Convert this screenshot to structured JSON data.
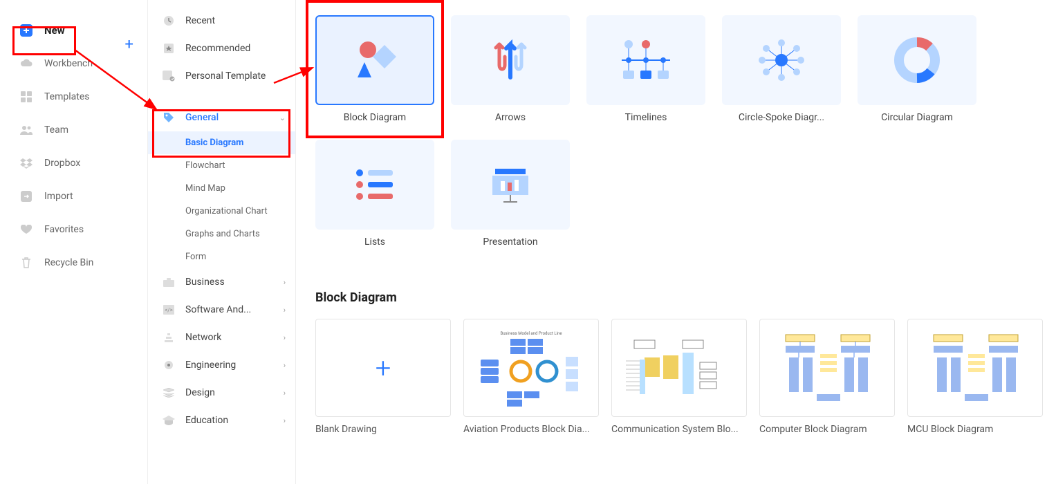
{
  "leftNav": {
    "new": "New",
    "workbench": "Workbench",
    "templates": "Templates",
    "team": "Team",
    "dropbox": "Dropbox",
    "import": "Import",
    "favorites": "Favorites",
    "recycle": "Recycle Bin"
  },
  "catNav": {
    "recent": "Recent",
    "recommended": "Recommended",
    "personal": "Personal Template",
    "general": "General",
    "general_subs": {
      "basic": "Basic Diagram",
      "flowchart": "Flowchart",
      "mindmap": "Mind Map",
      "orgchart": "Organizational Chart",
      "graphs": "Graphs and Charts",
      "form": "Form"
    },
    "business": "Business",
    "software": "Software And...",
    "network": "Network",
    "engineering": "Engineering",
    "design": "Design",
    "education": "Education"
  },
  "cards": {
    "block": "Block Diagram",
    "arrows": "Arrows",
    "timelines": "Timelines",
    "circlespoke": "Circle-Spoke Diagr...",
    "circular": "Circular Diagram",
    "lists": "Lists",
    "presentation": "Presentation"
  },
  "section": {
    "title": "Block Diagram"
  },
  "templates": {
    "blank": "Blank Drawing",
    "aviation": "Aviation Products Block Dia...",
    "communication": "Communication System Blo...",
    "computer": "Computer Block Diagram",
    "mcu": "MCU Block Diagram"
  }
}
